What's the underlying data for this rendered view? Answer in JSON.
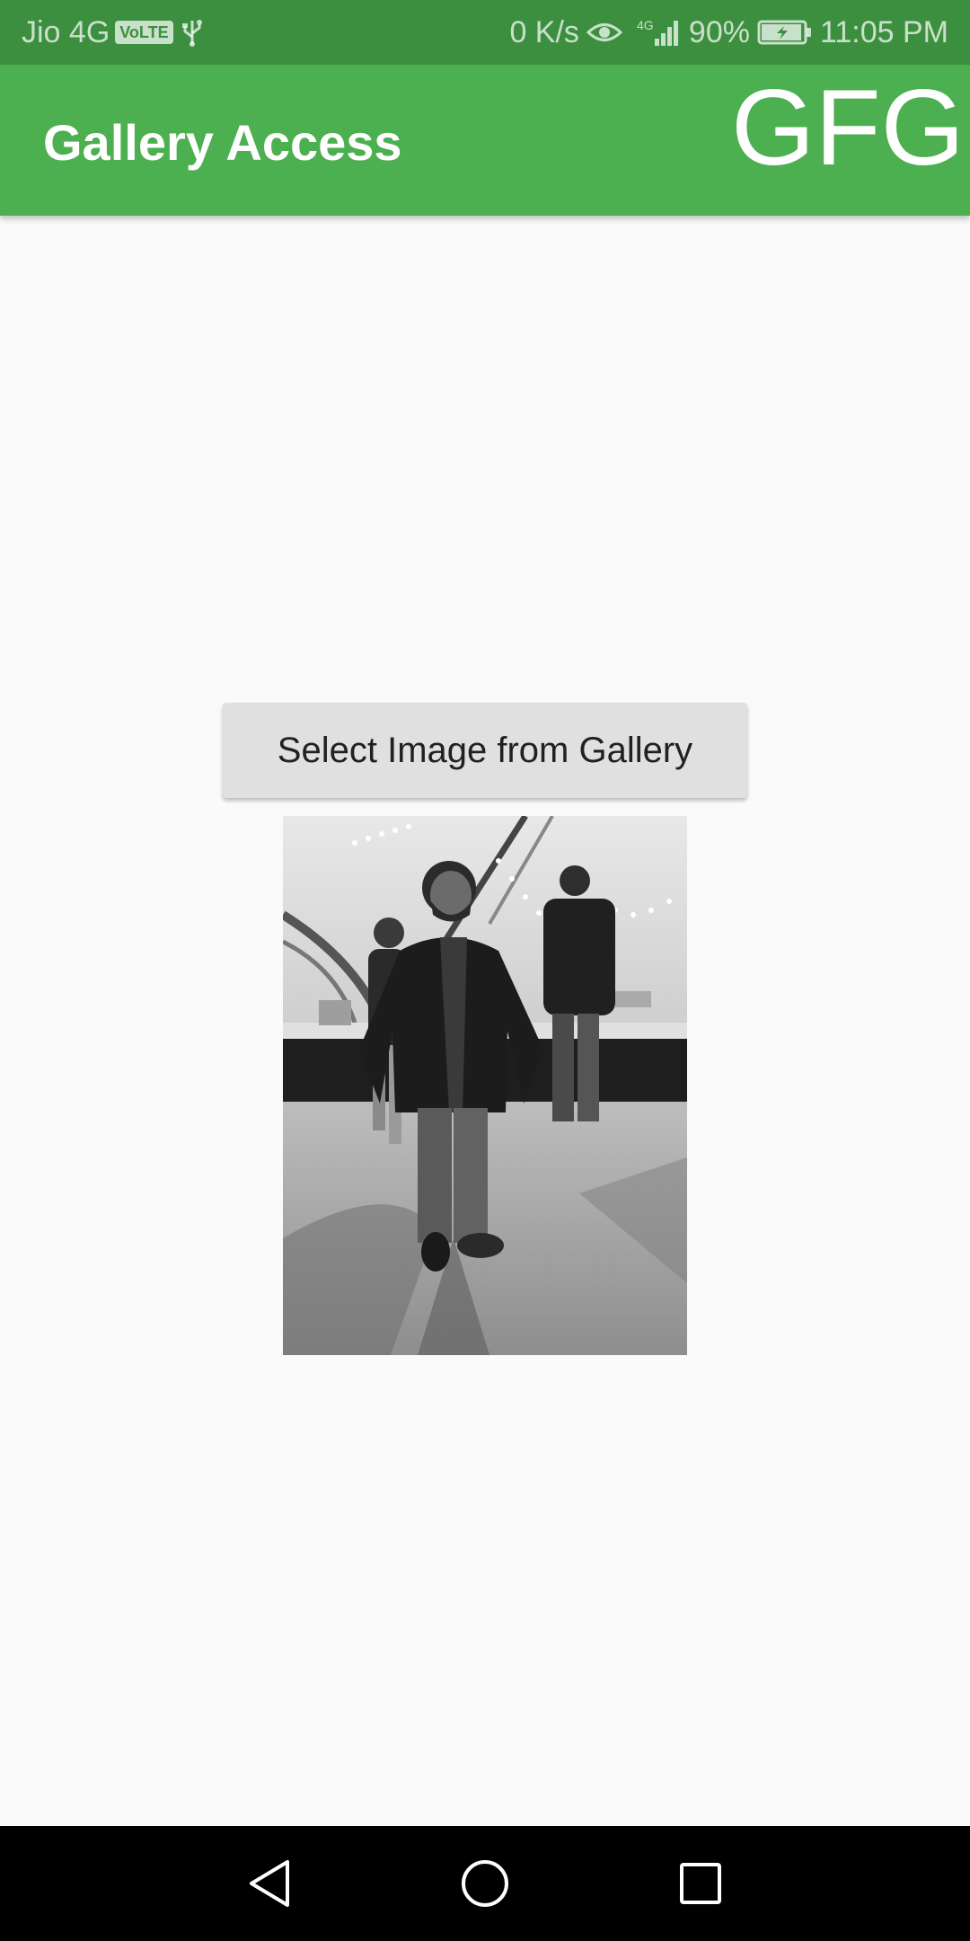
{
  "status_bar": {
    "carrier": "Jio 4G",
    "volte": "VoLTE",
    "usb_icon": "usb-icon",
    "net_speed": "0 K/s",
    "eye_icon": "eye-icon",
    "signal_icon": "signal-icon",
    "network_type": "4G",
    "battery_percent": "90%",
    "battery_icon": "battery-charging-icon",
    "time": "11:05 PM",
    "bg_color": "#3d8f40"
  },
  "app_bar": {
    "title": "Gallery Access",
    "logo_text": "GFG",
    "color": "#4caf50"
  },
  "main": {
    "select_button_label": "Select Image from Gallery",
    "image_alt": "selected grayscale photo"
  },
  "nav_bar": {
    "back_icon": "back-triangle-icon",
    "home_icon": "home-circle-icon",
    "recents_icon": "recents-square-icon"
  }
}
